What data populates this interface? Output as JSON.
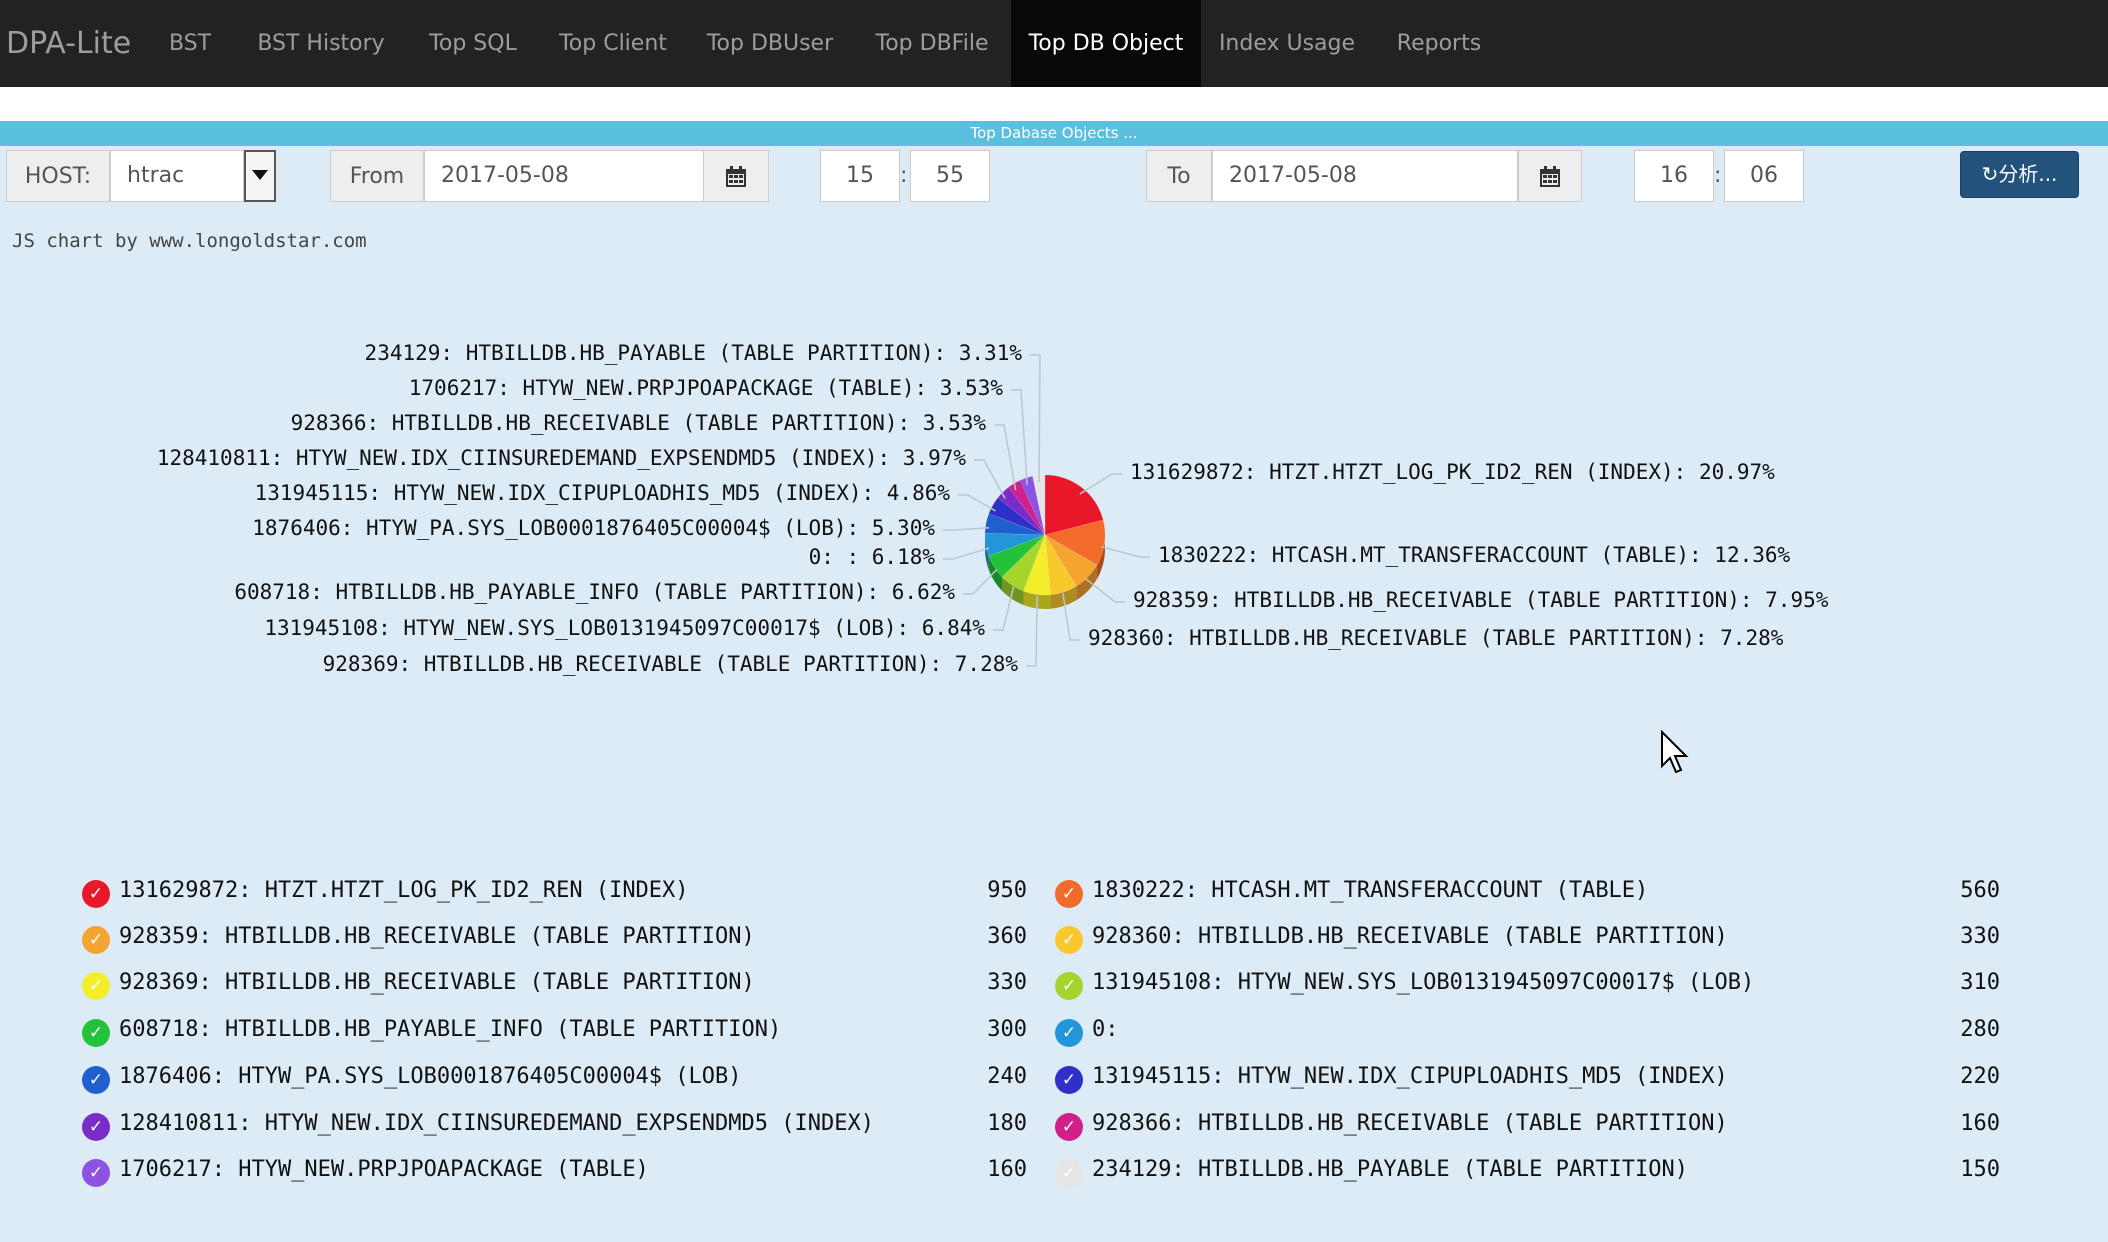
{
  "navbar": {
    "brand": "DPA-Lite",
    "items": [
      {
        "label": "BST"
      },
      {
        "label": "BST History"
      },
      {
        "label": "Top SQL"
      },
      {
        "label": "Top Client"
      },
      {
        "label": "Top DBUser"
      },
      {
        "label": "Top DBFile"
      },
      {
        "label": "Top DB Object",
        "active": true
      },
      {
        "label": "Index Usage"
      },
      {
        "label": "Reports"
      }
    ]
  },
  "title_bar": "Top Dabase Objects ...",
  "filters": {
    "host_label": "HOST:",
    "host_value": "htrac",
    "from_label": "From",
    "from_date": "2017-05-08",
    "from_hour": "15",
    "from_minute": "55",
    "to_label": "To",
    "to_date": "2017-05-08",
    "to_hour": "16",
    "to_minute": "06",
    "time_sep": ":",
    "analyze_label": "↻分析..."
  },
  "credit": "JS chart by www.longoldstar.com",
  "chart_data": {
    "type": "pie",
    "slices": [
      {
        "label": "131629872: HTZT.HTZT_LOG_PK_ID2_REN (INDEX): 20.97%",
        "name": "131629872: HTZT.HTZT_LOG_PK_ID2_REN (INDEX)",
        "value": 950,
        "percent": 20.97,
        "color": "#e8182a"
      },
      {
        "label": "1830222: HTCASH.MT_TRANSFERACCOUNT (TABLE): 12.36%",
        "name": "1830222: HTCASH.MT_TRANSFERACCOUNT (TABLE)",
        "value": 560,
        "percent": 12.36,
        "color": "#f26b2a"
      },
      {
        "label": "928359: HTBILLDB.HB_RECEIVABLE (TABLE PARTITION): 7.95%",
        "name": "928359: HTBILLDB.HB_RECEIVABLE (TABLE PARTITION)",
        "value": 360,
        "percent": 7.95,
        "color": "#f5a331"
      },
      {
        "label": "928360: HTBILLDB.HB_RECEIVABLE (TABLE PARTITION): 7.28%",
        "name": "928360: HTBILLDB.HB_RECEIVABLE (TABLE PARTITION)",
        "value": 330,
        "percent": 7.28,
        "color": "#f9c82d"
      },
      {
        "label": "928369: HTBILLDB.HB_RECEIVABLE (TABLE PARTITION): 7.28%",
        "name": "928369: HTBILLDB.HB_RECEIVABLE (TABLE PARTITION)",
        "value": 330,
        "percent": 7.28,
        "color": "#f4ee2a"
      },
      {
        "label": "131945108: HTYW_NEW.SYS_LOB0131945097C00017$ (LOB): 6.84%",
        "name": "131945108: HTYW_NEW.SYS_LOB0131945097C00017$ (LOB)",
        "value": 310,
        "percent": 6.84,
        "color": "#a5d52c"
      },
      {
        "label": "608718: HTBILLDB.HB_PAYABLE_INFO (TABLE PARTITION): 6.62%",
        "name": "608718: HTBILLDB.HB_PAYABLE_INFO (TABLE PARTITION)",
        "value": 300,
        "percent": 6.62,
        "color": "#24c23a"
      },
      {
        "label": "0: : 6.18%",
        "name": "0:",
        "value": 280,
        "percent": 6.18,
        "color": "#2396d9"
      },
      {
        "label": "1876406: HTYW_PA.SYS_LOB0001876405C00004$ (LOB): 5.30%",
        "name": "1876406: HTYW_PA.SYS_LOB0001876405C00004$ (LOB)",
        "value": 240,
        "percent": 5.3,
        "color": "#1f5fd0"
      },
      {
        "label": "131945115: HTYW_NEW.IDX_CIPUPLOADHIS_MD5 (INDEX): 4.86%",
        "name": "131945115: HTYW_NEW.IDX_CIPUPLOADHIS_MD5 (INDEX)",
        "value": 220,
        "percent": 4.86,
        "color": "#2f2fc9"
      },
      {
        "label": "128410811: HTYW_NEW.IDX_CIINSUREDEMAND_EXPSENDMD5 (INDEX): 3.97%",
        "name": "128410811: HTYW_NEW.IDX_CIINSUREDEMAND_EXPSENDMD5 (INDEX)",
        "value": 180,
        "percent": 3.97,
        "color": "#7b2cc8"
      },
      {
        "label": "928366: HTBILLDB.HB_RECEIVABLE (TABLE PARTITION): 3.53%",
        "name": "928366: HTBILLDB.HB_RECEIVABLE (TABLE PARTITION)",
        "value": 160,
        "percent": 3.53,
        "color": "#d1208a"
      },
      {
        "label": "1706217: HTYW_NEW.PRPJPOAPACKAGE (TABLE): 3.53%",
        "name": "1706217: HTYW_NEW.PRPJPOAPACKAGE (TABLE)",
        "value": 160,
        "percent": 3.53,
        "color": "#8c52e0"
      },
      {
        "label": "234129: HTBILLDB.HB_PAYABLE (TABLE PARTITION): 3.31%",
        "name": "234129: HTBILLDB.HB_PAYABLE (TABLE PARTITION)",
        "value": 150,
        "percent": 3.31,
        "color": "#e6e6e6"
      }
    ]
  }
}
